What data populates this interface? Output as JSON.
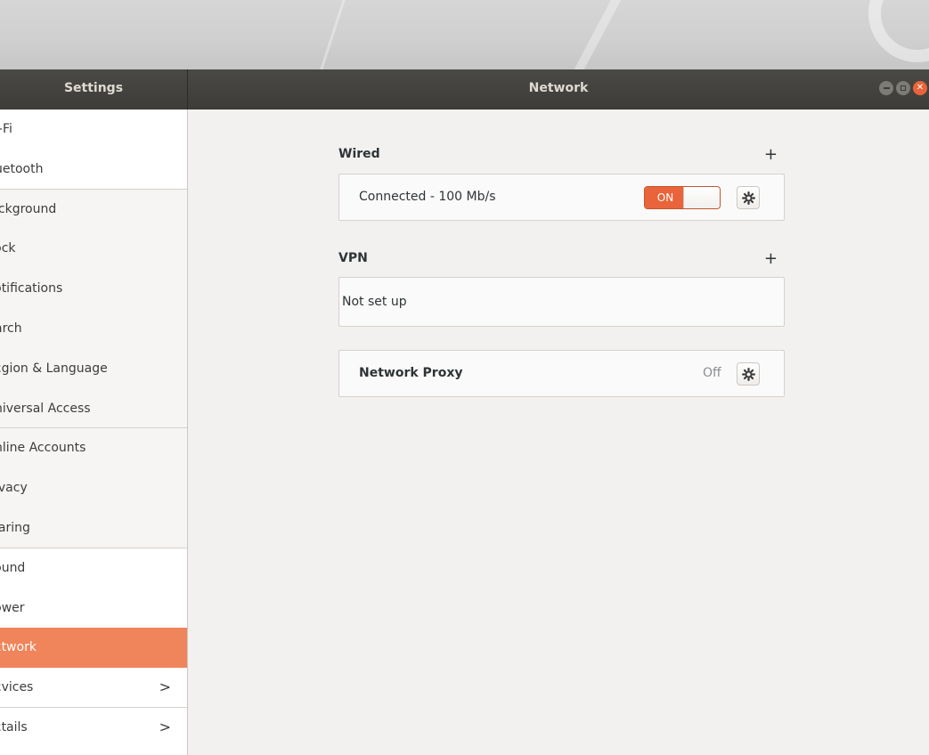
{
  "window": {
    "sidebar_title": "Settings",
    "content_title": "Network"
  },
  "sidebar": {
    "items": [
      {
        "label": "i-Fi",
        "chevron": ""
      },
      {
        "label": "uetooth",
        "chevron": ""
      },
      {
        "label": "ıckground",
        "chevron": ""
      },
      {
        "label": "ɔck",
        "chevron": ""
      },
      {
        "label": "ɔtifications",
        "chevron": ""
      },
      {
        "label": "arch",
        "chevron": ""
      },
      {
        "label": "ɛgion & Language",
        "chevron": ""
      },
      {
        "label": "niversal Access",
        "chevron": ""
      },
      {
        "label": "nline Accounts",
        "chevron": ""
      },
      {
        "label": "ivacy",
        "chevron": ""
      },
      {
        "label": "ıaring",
        "chevron": ""
      },
      {
        "label": "ɔund",
        "chevron": ""
      },
      {
        "label": "ɔwer",
        "chevron": ""
      },
      {
        "label": "ɛtwork",
        "chevron": ""
      },
      {
        "label": "ɛvices",
        "chevron": ">"
      },
      {
        "label": "ɛtails",
        "chevron": ">"
      }
    ],
    "active_index": 13
  },
  "wired": {
    "heading": "Wired",
    "add_symbol": "+",
    "status": "Connected - 100 Mb/s",
    "toggle_label": "ON"
  },
  "vpn": {
    "heading": "VPN",
    "add_symbol": "+",
    "status": "Not set up"
  },
  "proxy": {
    "label": "Network Proxy",
    "status": "Off"
  },
  "colors": {
    "accent": "#e9643a",
    "active_row": "#f0845a",
    "headerbar": "#3d3c38"
  }
}
